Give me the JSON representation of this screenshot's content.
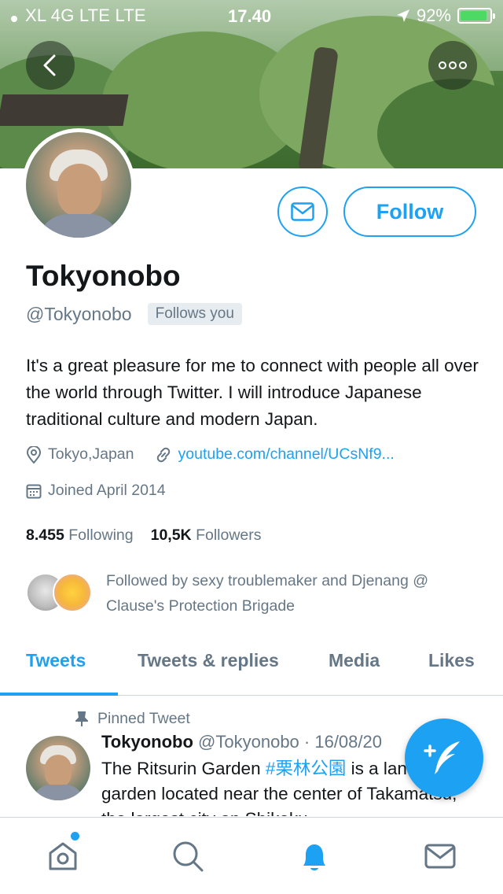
{
  "status_bar": {
    "carrier": "XL 4G LTE   LTE",
    "time": "17.40",
    "battery": "92%",
    "battery_level": 0.92
  },
  "profile": {
    "name": "Tokyonobo",
    "handle": "@Tokyonobo",
    "follows_you": "Follows you",
    "bio": "It's a great pleasure for me to connect with people all over the world through Twitter. I will introduce Japanese traditional culture and modern Japan.",
    "location": "Tokyo,Japan",
    "link": "youtube.com/channel/UCsNf9...",
    "joined": "Joined April 2014",
    "following_count": "8.455",
    "following_label": "Following",
    "followers_count": "10,5K",
    "followers_label": "Followers",
    "followed_by": "Followed by sexy troublemaker and Djenang @ Clause's Protection Brigade"
  },
  "actions": {
    "follow_label": "Follow"
  },
  "tabs": [
    {
      "label": "Tweets",
      "active": true
    },
    {
      "label": "Tweets & replies",
      "active": false
    },
    {
      "label": "Media",
      "active": false
    },
    {
      "label": "Likes",
      "active": false
    }
  ],
  "pinned_tweet": {
    "pinned_label": "Pinned Tweet",
    "author": "Tokyonobo",
    "handle_date": "@Tokyonobo · 16/08/20",
    "text_before": "The Ritsurin Garden ",
    "hashtag": "#栗林公園",
    "text_after": " is a landscape garden located near the center of Takamatsu, the largest city on Shikoku"
  },
  "colors": {
    "accent": "#1da1f2",
    "muted": "#657786",
    "text": "#14171a"
  },
  "icons": {
    "back": "chevron-left-icon",
    "more": "more-dots-icon",
    "message": "mail-icon",
    "location": "location-pin-icon",
    "link": "link-icon",
    "calendar": "calendar-icon",
    "pin": "pin-icon",
    "compose": "compose-tweet-icon",
    "home": "home-icon",
    "search": "search-icon",
    "notifications": "bell-icon",
    "messages": "envelope-icon"
  }
}
